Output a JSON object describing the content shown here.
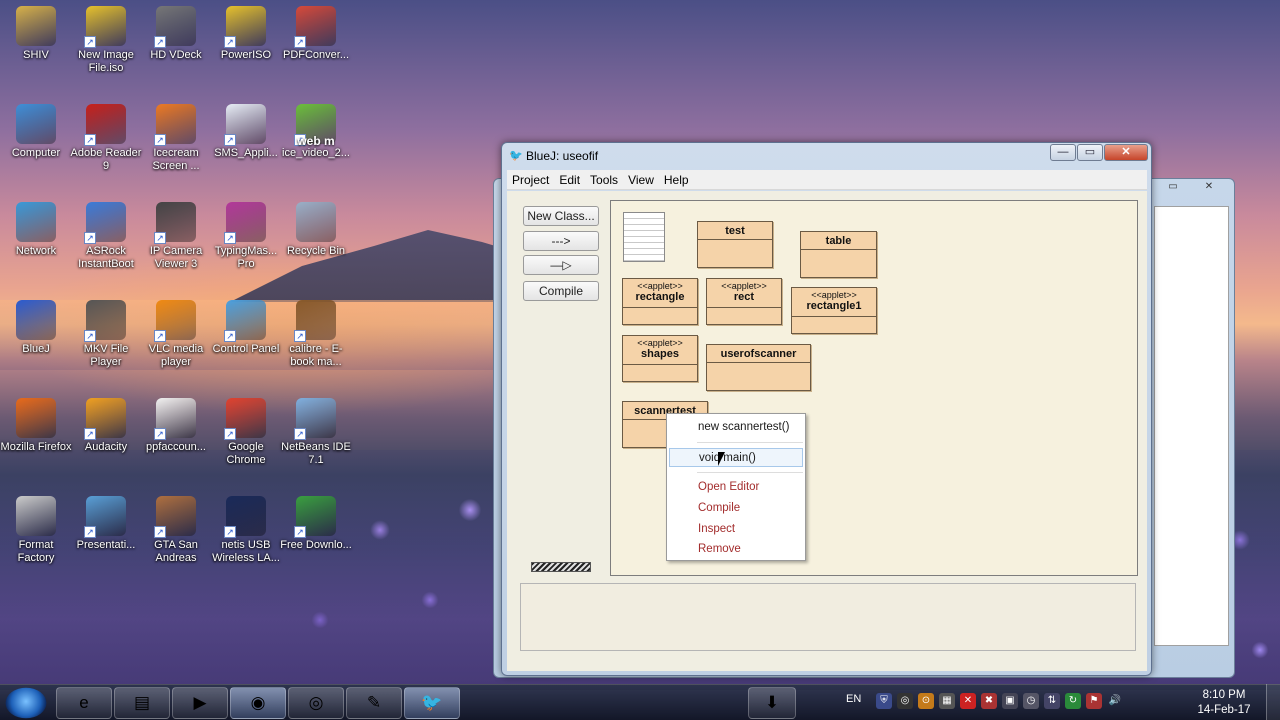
{
  "desktop": {
    "icons": [
      {
        "label": "SHIV",
        "icon": "folder-user-icon",
        "color": "#d9b24a"
      },
      {
        "label": "New Image File.iso",
        "icon": "disc-image-icon",
        "color": "#e8c22c"
      },
      {
        "label": "HD VDeck",
        "icon": "hd-vdeck-icon",
        "color": "#777777"
      },
      {
        "label": "PowerISO",
        "icon": "poweriso-icon",
        "color": "#e8c22c"
      },
      {
        "label": "PDFConver...",
        "icon": "pdf-converter-icon",
        "color": "#d84a3a"
      },
      {
        "label": "Computer",
        "icon": "computer-icon",
        "color": "#3f8fd8"
      },
      {
        "label": "Adobe Reader 9",
        "icon": "adobe-reader-icon",
        "color": "#c8201a"
      },
      {
        "label": "Icecream Screen ...",
        "icon": "icecream-icon",
        "color": "#ee7a22"
      },
      {
        "label": "SMS_Appli...",
        "icon": "document-icon",
        "color": "#e8eef6"
      },
      {
        "label": "ice_video_2...",
        "icon": "webm-video-icon",
        "color": "#6cc03a"
      },
      {
        "label": "Network",
        "icon": "network-icon",
        "color": "#3a9ad8"
      },
      {
        "label": "ASRock InstantBoot",
        "icon": "asrock-icon",
        "color": "#3b7cd9"
      },
      {
        "label": "IP Camera Viewer 3",
        "icon": "ip-camera-icon",
        "color": "#444444"
      },
      {
        "label": "TypingMas... Pro",
        "icon": "typingmaster-icon",
        "color": "#b3389a"
      },
      {
        "label": "Recycle Bin",
        "icon": "recycle-bin-icon",
        "color": "#9ab0c8"
      },
      {
        "label": "BlueJ",
        "icon": "bluej-icon",
        "color": "#2a5bd0"
      },
      {
        "label": "MKV File Player",
        "icon": "mkv-player-icon",
        "color": "#555555"
      },
      {
        "label": "VLC media player",
        "icon": "vlc-icon",
        "color": "#f08a12"
      },
      {
        "label": "Control Panel",
        "icon": "control-panel-icon",
        "color": "#4aa0e0"
      },
      {
        "label": "calibre - E-book ma...",
        "icon": "calibre-icon",
        "color": "#8a5a2a"
      },
      {
        "label": "Mozilla Firefox",
        "icon": "firefox-icon",
        "color": "#e86a1a"
      },
      {
        "label": "Audacity",
        "icon": "audacity-icon",
        "color": "#f0a020"
      },
      {
        "label": "ppfaccoun...",
        "icon": "pdf-document-icon",
        "color": "#f2f2f2"
      },
      {
        "label": "Google Chrome",
        "icon": "chrome-icon",
        "color": "#e0412f"
      },
      {
        "label": "NetBeans IDE 7.1",
        "icon": "netbeans-icon",
        "color": "#7fb0e0"
      },
      {
        "label": "Format Factory",
        "icon": "format-factory-icon",
        "color": "#cccccc"
      },
      {
        "label": "Presentati...",
        "icon": "presentation-icon",
        "color": "#5aa0d8"
      },
      {
        "label": "GTA San Andreas",
        "icon": "gta-icon",
        "color": "#b07040"
      },
      {
        "label": "netis USB Wireless LA...",
        "icon": "netis-icon",
        "color": "#1a2a5a"
      },
      {
        "label": "Free Downlo...",
        "icon": "free-download-icon",
        "color": "#3aa040"
      }
    ],
    "webm_badge": "web m"
  },
  "bluej": {
    "title": "BlueJ:  useofif",
    "window_buttons": {
      "minimize": "—",
      "maximize": "▭",
      "close": "✕"
    },
    "menu": [
      "Project",
      "Edit",
      "Tools",
      "View",
      "Help"
    ],
    "toolbar": {
      "new_class": "New Class...",
      "uses_arrow": "--->",
      "inherits_arrow": "—▷",
      "compile": "Compile"
    },
    "classes": {
      "test": {
        "name": "test"
      },
      "table": {
        "name": "table"
      },
      "rectangle": {
        "stereo": "<<applet>>",
        "name": "rectangle"
      },
      "rect": {
        "stereo": "<<applet>>",
        "name": "rect"
      },
      "rectangle1": {
        "stereo": "<<applet>>",
        "name": "rectangle1"
      },
      "shapes": {
        "stereo": "<<applet>>",
        "name": "shapes"
      },
      "userofscanner": {
        "name": "userofscanner"
      },
      "scannertest": {
        "name": "scannertest"
      }
    },
    "context_menu": {
      "items": [
        {
          "label": "new scannertest()",
          "style": "normal"
        },
        {
          "label": "void main()",
          "style": "selected"
        },
        {
          "label": "Open Editor",
          "style": "red"
        },
        {
          "label": "Compile",
          "style": "red"
        },
        {
          "label": "Inspect",
          "style": "red"
        },
        {
          "label": "Remove",
          "style": "red"
        }
      ]
    }
  },
  "taskbar": {
    "language": "EN",
    "time": "8:10 PM",
    "date": "14-Feb-17",
    "pinned": [
      "ie-icon",
      "explorer-icon",
      "media-player-icon",
      "chrome-icon",
      "icecream-icon",
      "notepad-icon",
      "bluej-icon"
    ]
  },
  "colors": {
    "class_fill": "#f5d3a9",
    "canvas": "#f6f1de",
    "menu_red": "#a32d2d"
  }
}
